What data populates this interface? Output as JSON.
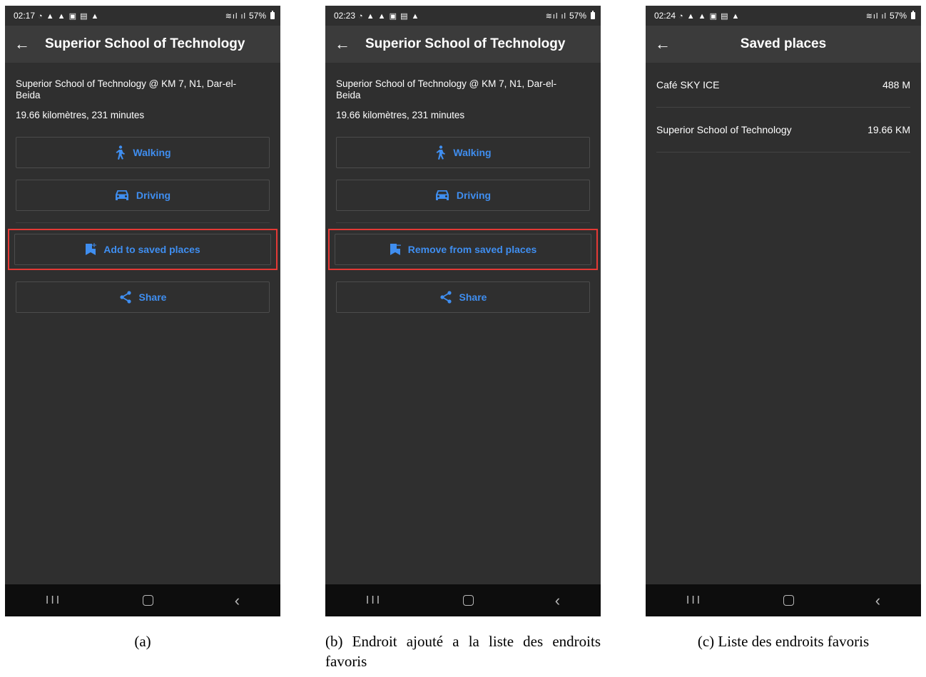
{
  "screens": [
    {
      "status": {
        "time": "02:17",
        "battery": "57%"
      },
      "title": "Superior School of Technology",
      "address": "Superior School of Technology @ KM 7, N1, Dar-el-Beida",
      "distance": "19.66 kilomètres, 231 minutes",
      "buttons": {
        "walking": "Walking",
        "driving": "Driving",
        "saved": "Add to saved places",
        "share": "Share"
      }
    },
    {
      "status": {
        "time": "02:23",
        "battery": "57%"
      },
      "title": "Superior School of Technology",
      "address": "Superior School of Technology @ KM 7, N1, Dar-el-Beida",
      "distance": "19.66 kilomètres, 231 minutes",
      "buttons": {
        "walking": "Walking",
        "driving": "Driving",
        "saved": "Remove from saved places",
        "share": "Share"
      }
    },
    {
      "status": {
        "time": "02:24",
        "battery": "57%"
      },
      "title": "Saved places",
      "places": [
        {
          "name": "Café SKY ICE",
          "distance": "488 M"
        },
        {
          "name": "Superior School of Technology",
          "distance": "19.66 KM"
        }
      ]
    }
  ],
  "captions": [
    "(a)",
    "(b) Endroit ajouté a la liste des endroits favoris",
    "(c) Liste des endroits favoris"
  ],
  "colors": {
    "accent": "#3f8ef0",
    "highlight": "#e53935",
    "background": "#2f2f2f",
    "appbar": "#3b3b3b"
  },
  "icons": [
    "arrow-back-icon",
    "walk-icon",
    "car-icon",
    "bookmark-add-icon",
    "bookmark-remove-icon",
    "share-icon"
  ]
}
